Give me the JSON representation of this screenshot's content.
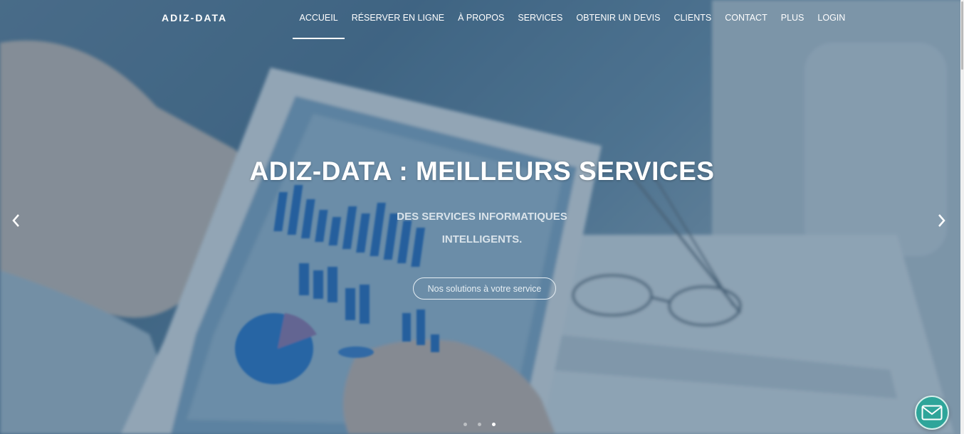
{
  "brand": "ADIZ-DATA",
  "nav": {
    "items": [
      {
        "label": "ACCUEIL",
        "active": true
      },
      {
        "label": "RÉSERVER EN LIGNE"
      },
      {
        "label": "À PROPOS"
      },
      {
        "label": "SERVICES"
      },
      {
        "label": "OBTENIR UN DEVIS"
      },
      {
        "label": "CLIENTS"
      },
      {
        "label": "CONTACT"
      },
      {
        "label": "PLUS"
      },
      {
        "label": "LOGIN"
      }
    ]
  },
  "hero": {
    "title": "ADIZ-DATA : MEILLEURS SERVICES",
    "subtitle_line1": "DES SERVICES INFORMATIQUES",
    "subtitle_line2": "INTELLIGENTS.",
    "cta_label": "Nos solutions à votre service"
  },
  "carousel": {
    "slide_count": 3,
    "active_index": 2,
    "prev_icon": "chevron-left-icon",
    "next_icon": "chevron-right-icon"
  },
  "chat_icon": "envelope-icon",
  "colors": {
    "overlay": "#1e4669",
    "chat_button": "#2ea59a",
    "text_primary": "#ffffff",
    "text_secondary": "#d9e3ea"
  }
}
